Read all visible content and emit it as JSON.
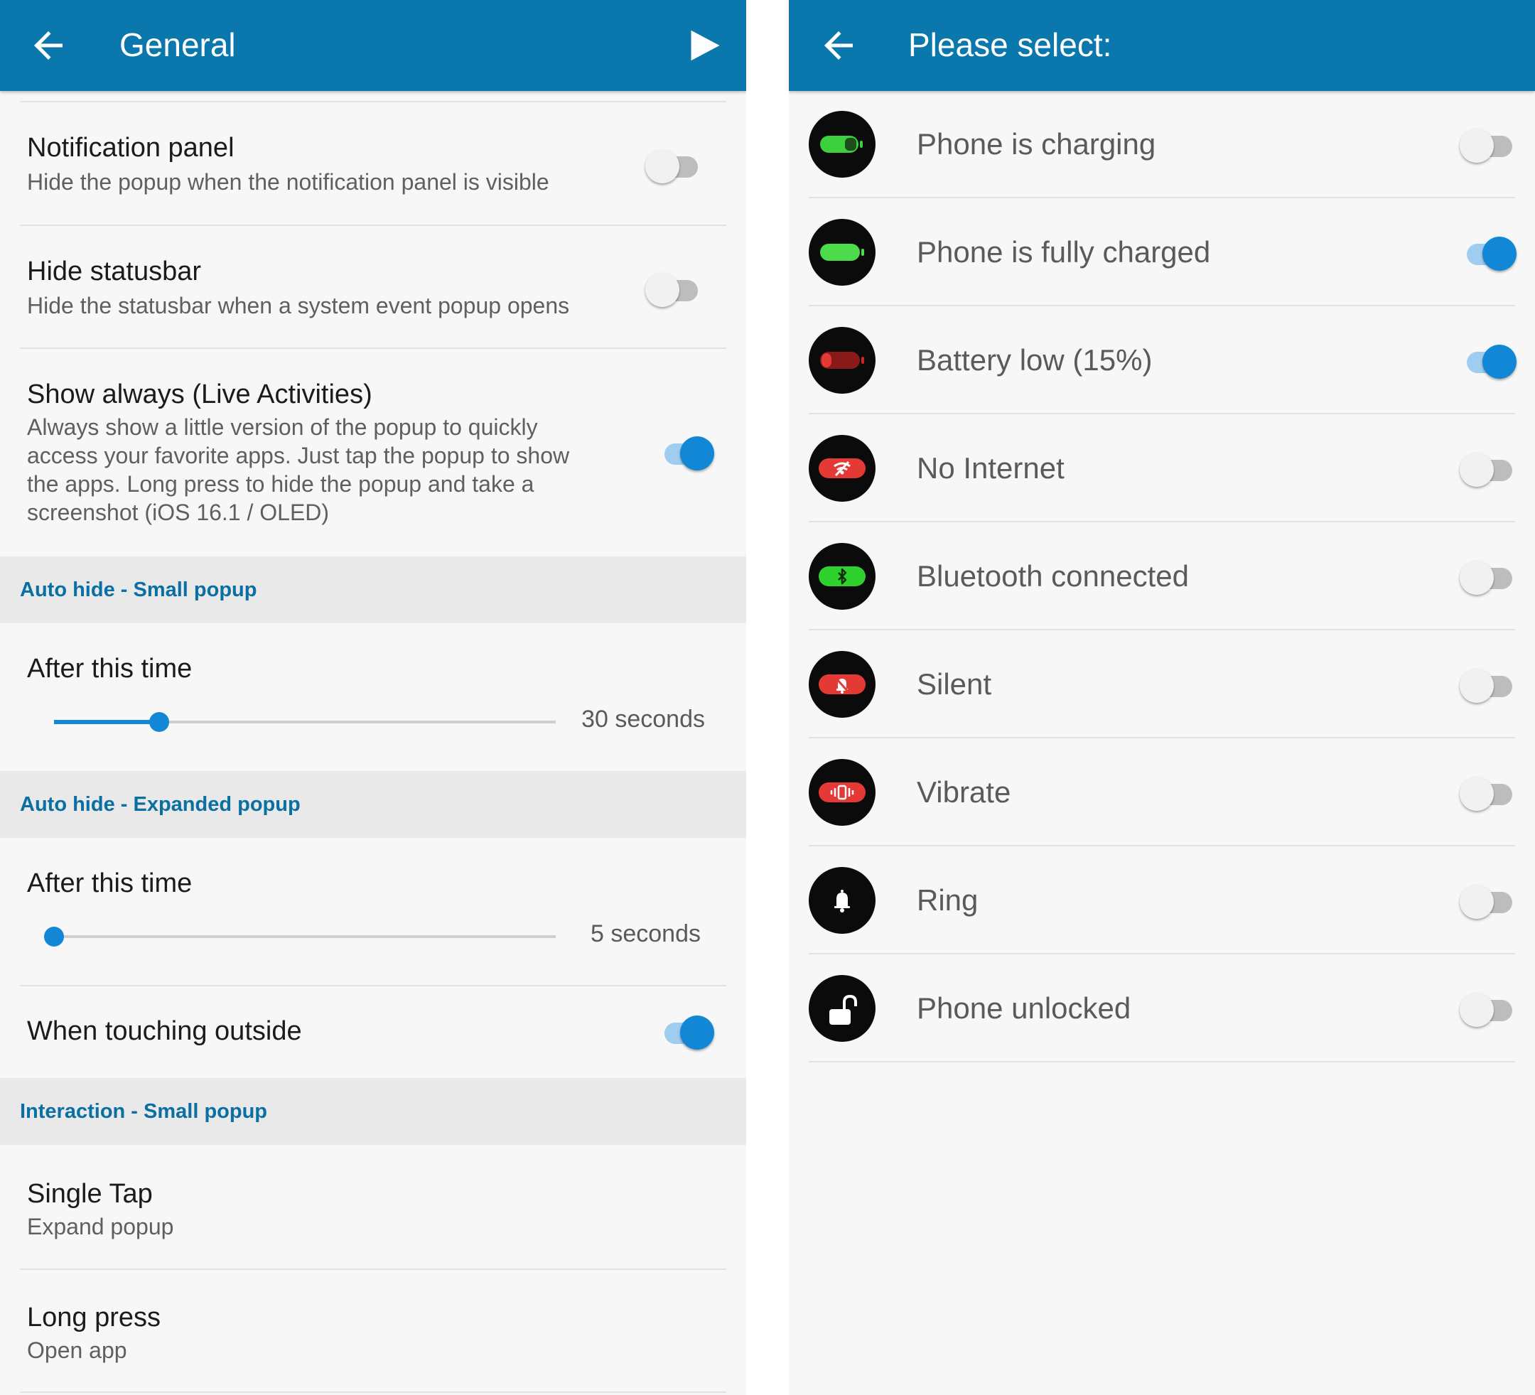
{
  "left": {
    "title": "General",
    "settings": [
      {
        "title": "Notification panel",
        "subtitle": "Hide the popup when the notification panel is visible",
        "enabled": false
      },
      {
        "title": "Hide statusbar",
        "subtitle": "Hide the statusbar when a system event popup opens",
        "enabled": false
      },
      {
        "title": "Show always (Live Activities)",
        "subtitle_lines": [
          "Always show a little version of the popup to quickly",
          "access your favorite apps. Just tap the popup to show",
          "the apps. Long press to hide the popup and take a",
          "screenshot (iOS 16.1 / OLED)"
        ],
        "enabled": true
      }
    ],
    "section_small": "Auto hide - Small popup",
    "small_after_label": "After this time",
    "small_value": "30 seconds",
    "small_fraction": 0.21,
    "section_expanded": "Auto hide - Expanded popup",
    "expanded_after_label": "After this time",
    "expanded_value": "5 seconds",
    "expanded_fraction": 0.0,
    "touch_outside": {
      "title": "When touching outside",
      "enabled": true
    },
    "section_interaction": "Interaction - Small popup",
    "single_tap": {
      "title": "Single Tap",
      "subtitle": "Expand popup"
    },
    "long_press": {
      "title": "Long press",
      "subtitle": "Open app"
    }
  },
  "right": {
    "title": "Please select:",
    "items": [
      {
        "label": "Phone is charging",
        "icon": "battery-charging-icon",
        "enabled": false
      },
      {
        "label": "Phone is fully charged",
        "icon": "battery-full-icon",
        "enabled": true
      },
      {
        "label": "Battery low (15%)",
        "icon": "battery-low-icon",
        "enabled": true
      },
      {
        "label": "No Internet",
        "icon": "no-wifi-icon",
        "enabled": false
      },
      {
        "label": "Bluetooth connected",
        "icon": "bluetooth-icon",
        "enabled": false
      },
      {
        "label": "Silent",
        "icon": "bell-off-icon",
        "enabled": false
      },
      {
        "label": "Vibrate",
        "icon": "vibrate-icon",
        "enabled": false
      },
      {
        "label": "Ring",
        "icon": "bell-icon",
        "enabled": false
      },
      {
        "label": "Phone unlocked",
        "icon": "unlock-icon",
        "enabled": false
      }
    ]
  },
  "colors": {
    "appbar": "#0a78ad",
    "accent": "#1187d6",
    "section_text": "#0a6fa3",
    "green": "#3ecf3e",
    "red": "#e53935"
  }
}
